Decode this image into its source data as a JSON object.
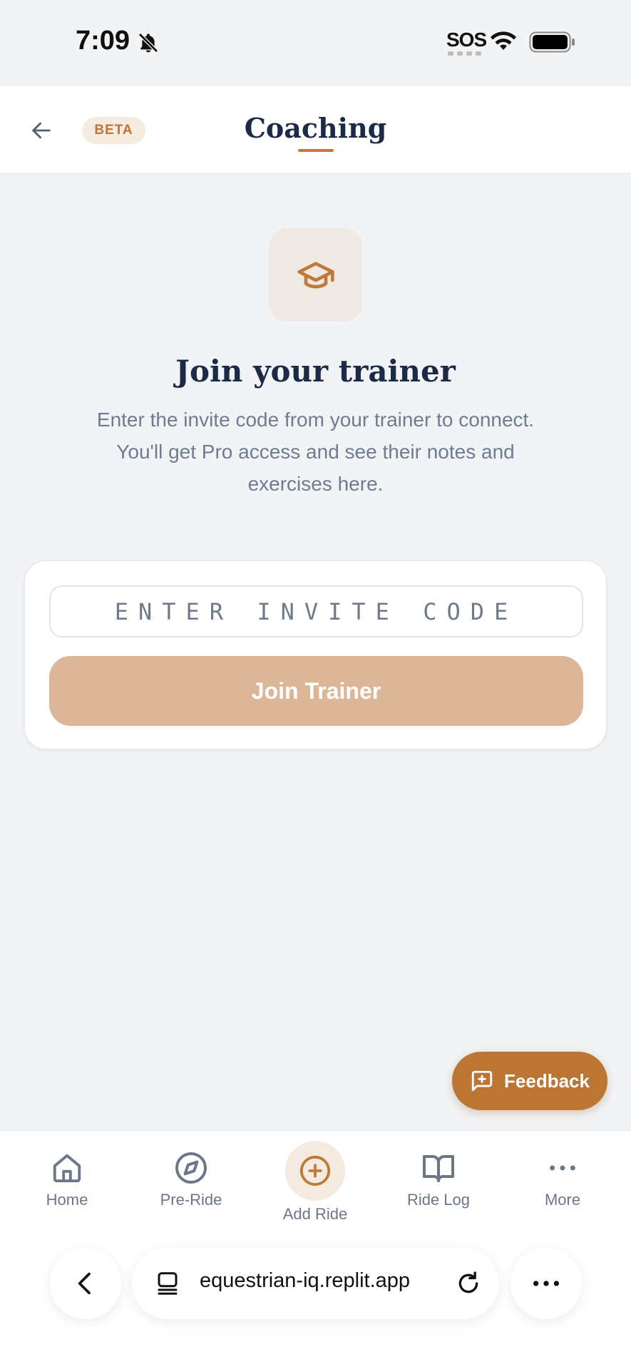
{
  "status_bar": {
    "time": "7:09",
    "sos": "SOS"
  },
  "header": {
    "badge": "BETA",
    "title": "Coaching"
  },
  "hero": {
    "title": "Join your trainer",
    "description": "Enter the invite code from your trainer to connect. You'll get Pro access and see their notes and exercises here."
  },
  "join_form": {
    "invite_placeholder": "ENTER INVITE CODE",
    "invite_value": "",
    "join_label": "Join Trainer"
  },
  "feedback": {
    "label": "Feedback"
  },
  "bottom_nav": {
    "items": [
      {
        "label": "Home",
        "icon": "home-icon"
      },
      {
        "label": "Pre-Ride",
        "icon": "compass-icon"
      },
      {
        "label": "Add Ride",
        "icon": "plus-circle-icon"
      },
      {
        "label": "Ride Log",
        "icon": "book-icon"
      },
      {
        "label": "More",
        "icon": "more-horizontal-icon"
      }
    ]
  },
  "browser": {
    "url": "equestrian-iq.replit.app"
  },
  "colors": {
    "accent": "#bd7534",
    "accent_disabled": "#dcb797",
    "navy": "#1a2a47",
    "muted": "#6e7c92",
    "background": "#f2f3f5"
  }
}
